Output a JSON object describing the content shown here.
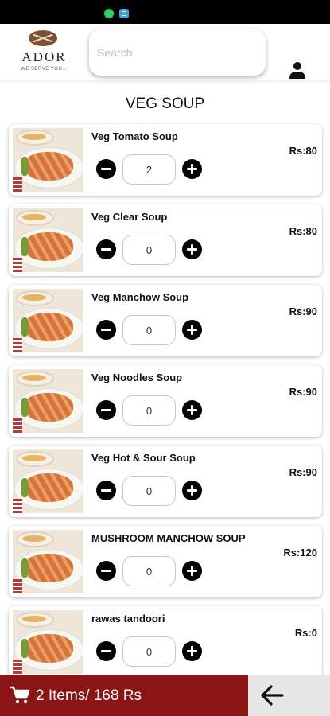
{
  "header": {
    "logo_text": "ADOR",
    "logo_tagline": "WE SERVE YOU...",
    "search_value": "",
    "search_placeholder": "Search"
  },
  "page": {
    "title": "VEG SOUP"
  },
  "items": [
    {
      "name": "Veg Tomato Soup",
      "price": "Rs:80",
      "quantity": "2"
    },
    {
      "name": "Veg Clear Soup",
      "price": "Rs:80",
      "quantity": "0"
    },
    {
      "name": "Veg Manchow Soup",
      "price": "Rs:90",
      "quantity": "0"
    },
    {
      "name": "Veg Noodles Soup",
      "price": "Rs:90",
      "quantity": "0"
    },
    {
      "name": "Veg Hot & Sour Soup",
      "price": "Rs:90",
      "quantity": "0"
    },
    {
      "name": "MUSHROOM MANCHOW SOUP",
      "price": "Rs:120",
      "quantity": "0"
    },
    {
      "name": "rawas tandoori",
      "price": "Rs:0",
      "quantity": "0"
    }
  ],
  "cart": {
    "summary": "2 Items/ 168 Rs"
  },
  "icons": {
    "user": "user-icon",
    "cart": "cart-icon",
    "back": "arrow-left-icon",
    "minus": "minus-circle-icon",
    "plus": "plus-circle-icon"
  },
  "colors": {
    "cart_bar": "#8b1414",
    "back_button": "#e6e6e6",
    "buttons": "#000000"
  }
}
